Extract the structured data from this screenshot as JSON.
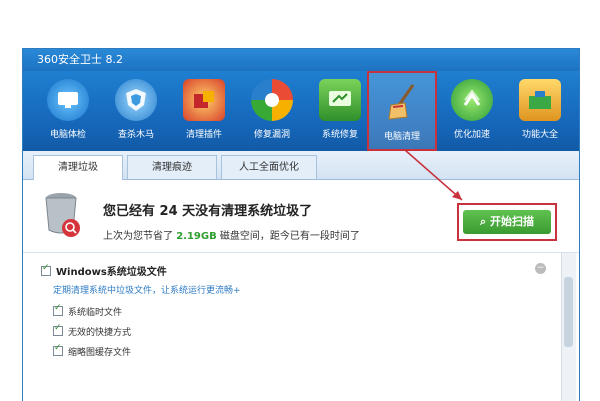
{
  "window": {
    "title": "360安全卫士 8.2"
  },
  "toolbar": {
    "items": [
      {
        "label": "电脑体检",
        "icon": "monitor-check-icon"
      },
      {
        "label": "查杀木马",
        "icon": "shield-icon"
      },
      {
        "label": "清理插件",
        "icon": "plugin-clean-icon"
      },
      {
        "label": "修复漏洞",
        "icon": "patch-repair-icon"
      },
      {
        "label": "系统修复",
        "icon": "system-repair-icon"
      },
      {
        "label": "电脑清理",
        "icon": "broom-icon"
      },
      {
        "label": "优化加速",
        "icon": "rocket-speed-icon"
      },
      {
        "label": "功能大全",
        "icon": "toolbox-icon"
      }
    ],
    "active_index": 5
  },
  "tabs": [
    {
      "label": "清理垃圾"
    },
    {
      "label": "清理痕迹"
    },
    {
      "label": "人工全面优化"
    }
  ],
  "summary": {
    "headline": "您已经有 24 天没有清理系统垃圾了",
    "sub_prefix": "上次为您节省了",
    "sub_amount": "2.19GB",
    "sub_suffix": "磁盘空间，距今已有一段时间了",
    "scan_button": "开始扫描"
  },
  "list": {
    "section_title": "Windows系统垃圾文件",
    "section_desc": "定期清理系统中垃圾文件，让系统运行更流畅+",
    "items": [
      "系统临时文件",
      "无效的快捷方式",
      "缩略图缓存文件"
    ]
  },
  "colors": {
    "accent": "#1d72c2",
    "highlight": "#c8323c",
    "button_green": "#3a9a30"
  }
}
